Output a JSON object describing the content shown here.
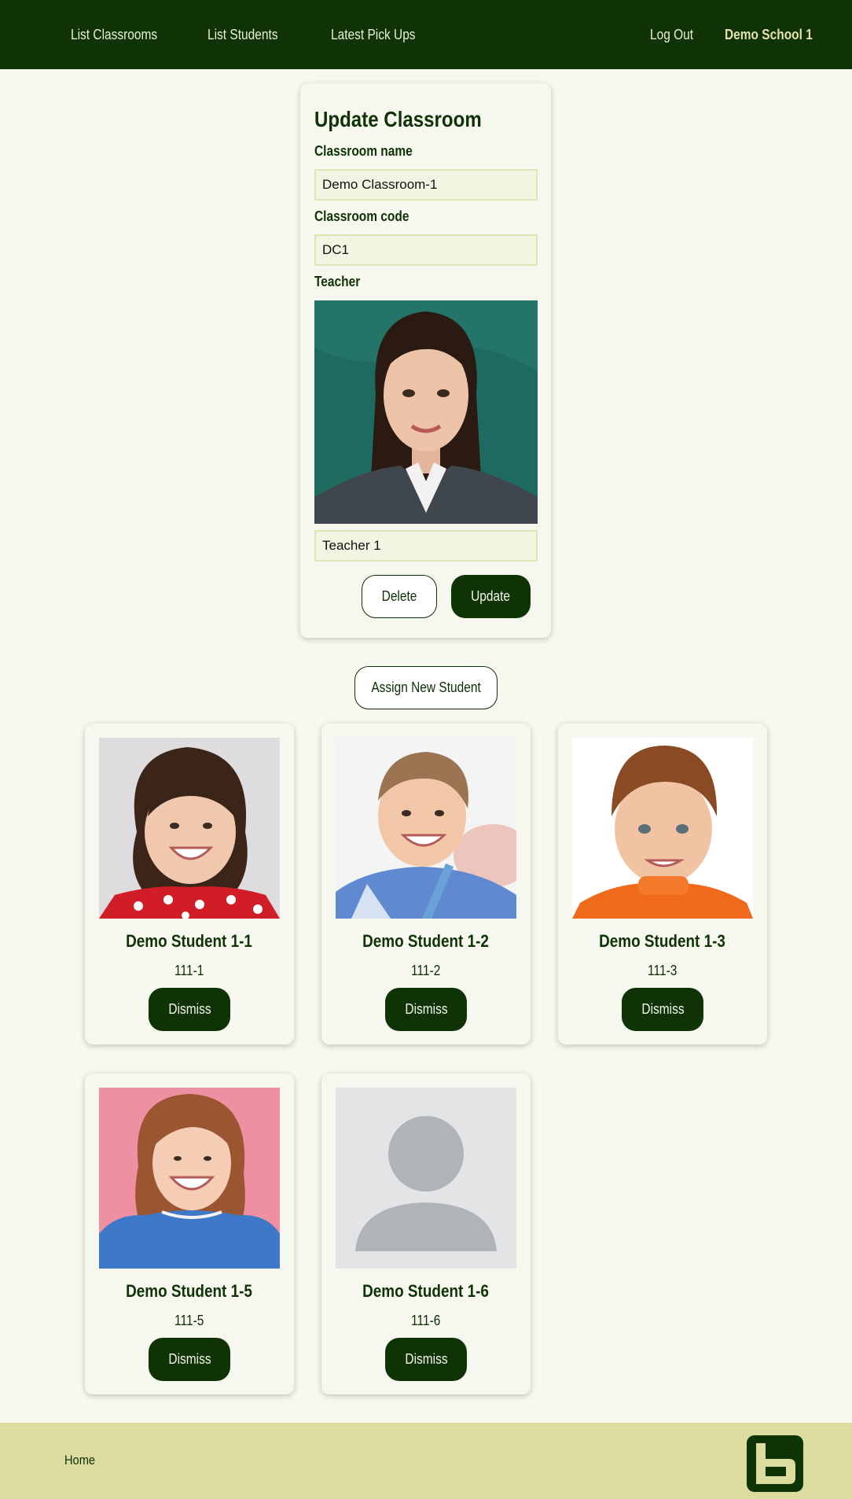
{
  "nav": {
    "list_classrooms": "List Classrooms",
    "list_students": "List Students",
    "latest_pickups": "Latest Pick Ups",
    "logout": "Log Out",
    "school_name": "Demo School 1"
  },
  "form": {
    "title": "Update Classroom",
    "classroom_name_label": "Classroom name",
    "classroom_name_value": "Demo Classroom-1",
    "classroom_code_label": "Classroom code",
    "classroom_code_value": "DC1",
    "teacher_label": "Teacher",
    "teacher_value": "Teacher 1",
    "delete_label": "Delete",
    "update_label": "Update"
  },
  "assign_button_label": "Assign New Student",
  "students": [
    {
      "name": "Demo Student 1-1",
      "code": "111-1",
      "action": "Dismiss"
    },
    {
      "name": "Demo Student 1-2",
      "code": "111-2",
      "action": "Dismiss"
    },
    {
      "name": "Demo Student 1-3",
      "code": "111-3",
      "action": "Dismiss"
    },
    {
      "name": "Demo Student 1-5",
      "code": "111-5",
      "action": "Dismiss"
    },
    {
      "name": "Demo Student 1-6",
      "code": "111-6",
      "action": "Dismiss"
    }
  ],
  "footer": {
    "home_label": "Home"
  },
  "colors": {
    "primary": "#0f3305",
    "background": "#f7f9f0",
    "footer": "#dcdc9e",
    "school_name": "#e3e2a8"
  }
}
